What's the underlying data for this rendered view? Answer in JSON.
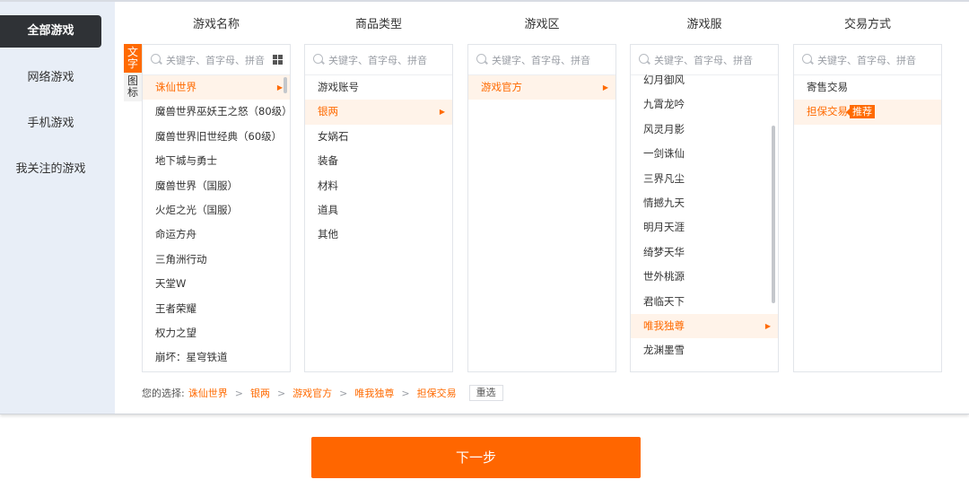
{
  "sidebar": {
    "items": [
      {
        "label": "全部游戏",
        "active": true
      },
      {
        "label": "网络游戏",
        "active": false
      },
      {
        "label": "手机游戏",
        "active": false
      },
      {
        "label": "我关注的游戏",
        "active": false
      }
    ]
  },
  "view_toggle": {
    "text_label": "文字",
    "icon_label": "图标",
    "active": "text"
  },
  "columns": [
    {
      "title": "游戏名称",
      "placeholder": "关键字、首字母、拼音",
      "has_grid_icon": true,
      "items": [
        {
          "label": "诛仙世界",
          "selected": true
        },
        {
          "label": "魔兽世界巫妖王之怒（80级）"
        },
        {
          "label": "魔兽世界旧世经典（60级）"
        },
        {
          "label": "地下城与勇士"
        },
        {
          "label": "魔兽世界（国服）"
        },
        {
          "label": "火炬之光（国服）"
        },
        {
          "label": "命运方舟"
        },
        {
          "label": "三角洲行动"
        },
        {
          "label": "天堂W"
        },
        {
          "label": "王者荣耀"
        },
        {
          "label": "权力之望"
        },
        {
          "label": "崩坏：星穹铁道"
        }
      ]
    },
    {
      "title": "商品类型",
      "placeholder": "关键字、首字母、拼音",
      "has_grid_icon": false,
      "items": [
        {
          "label": "游戏账号"
        },
        {
          "label": "银两",
          "selected": true
        },
        {
          "label": "女娲石"
        },
        {
          "label": "装备"
        },
        {
          "label": "材料"
        },
        {
          "label": "道具"
        },
        {
          "label": "其他"
        }
      ]
    },
    {
      "title": "游戏区",
      "placeholder": "关键字、首字母、拼音",
      "has_grid_icon": false,
      "items": [
        {
          "label": "游戏官方",
          "selected": true
        }
      ]
    },
    {
      "title": "游戏服",
      "placeholder": "关键字、首字母、拼音",
      "has_grid_icon": false,
      "items": [
        {
          "label": "幻月御风"
        },
        {
          "label": "九霄龙吟"
        },
        {
          "label": "风灵月影"
        },
        {
          "label": "一剑诛仙"
        },
        {
          "label": "三界凡尘"
        },
        {
          "label": "情撼九天"
        },
        {
          "label": "明月天涯"
        },
        {
          "label": "绮梦天华"
        },
        {
          "label": "世外桃源"
        },
        {
          "label": "君临天下"
        },
        {
          "label": "唯我独尊",
          "selected": true
        },
        {
          "label": "龙渊墨雪"
        }
      ]
    },
    {
      "title": "交易方式",
      "placeholder": "关键字、首字母、拼音",
      "has_grid_icon": false,
      "items": [
        {
          "label": "寄售交易"
        },
        {
          "label": "担保交易",
          "selected": true,
          "badge": "推荐"
        }
      ]
    }
  ],
  "breadcrumb": {
    "label": "您的选择:",
    "items": [
      "诛仙世界",
      "银两",
      "游戏官方",
      "唯我独尊",
      "担保交易"
    ],
    "reset_label": "重选"
  },
  "next_button": {
    "label": "下一步"
  },
  "colors": {
    "accent": "#ff6a00",
    "sidebar_bg": "#e8eef7",
    "active_dark": "#2f3236",
    "selected_row_bg": "#fff3e9"
  }
}
